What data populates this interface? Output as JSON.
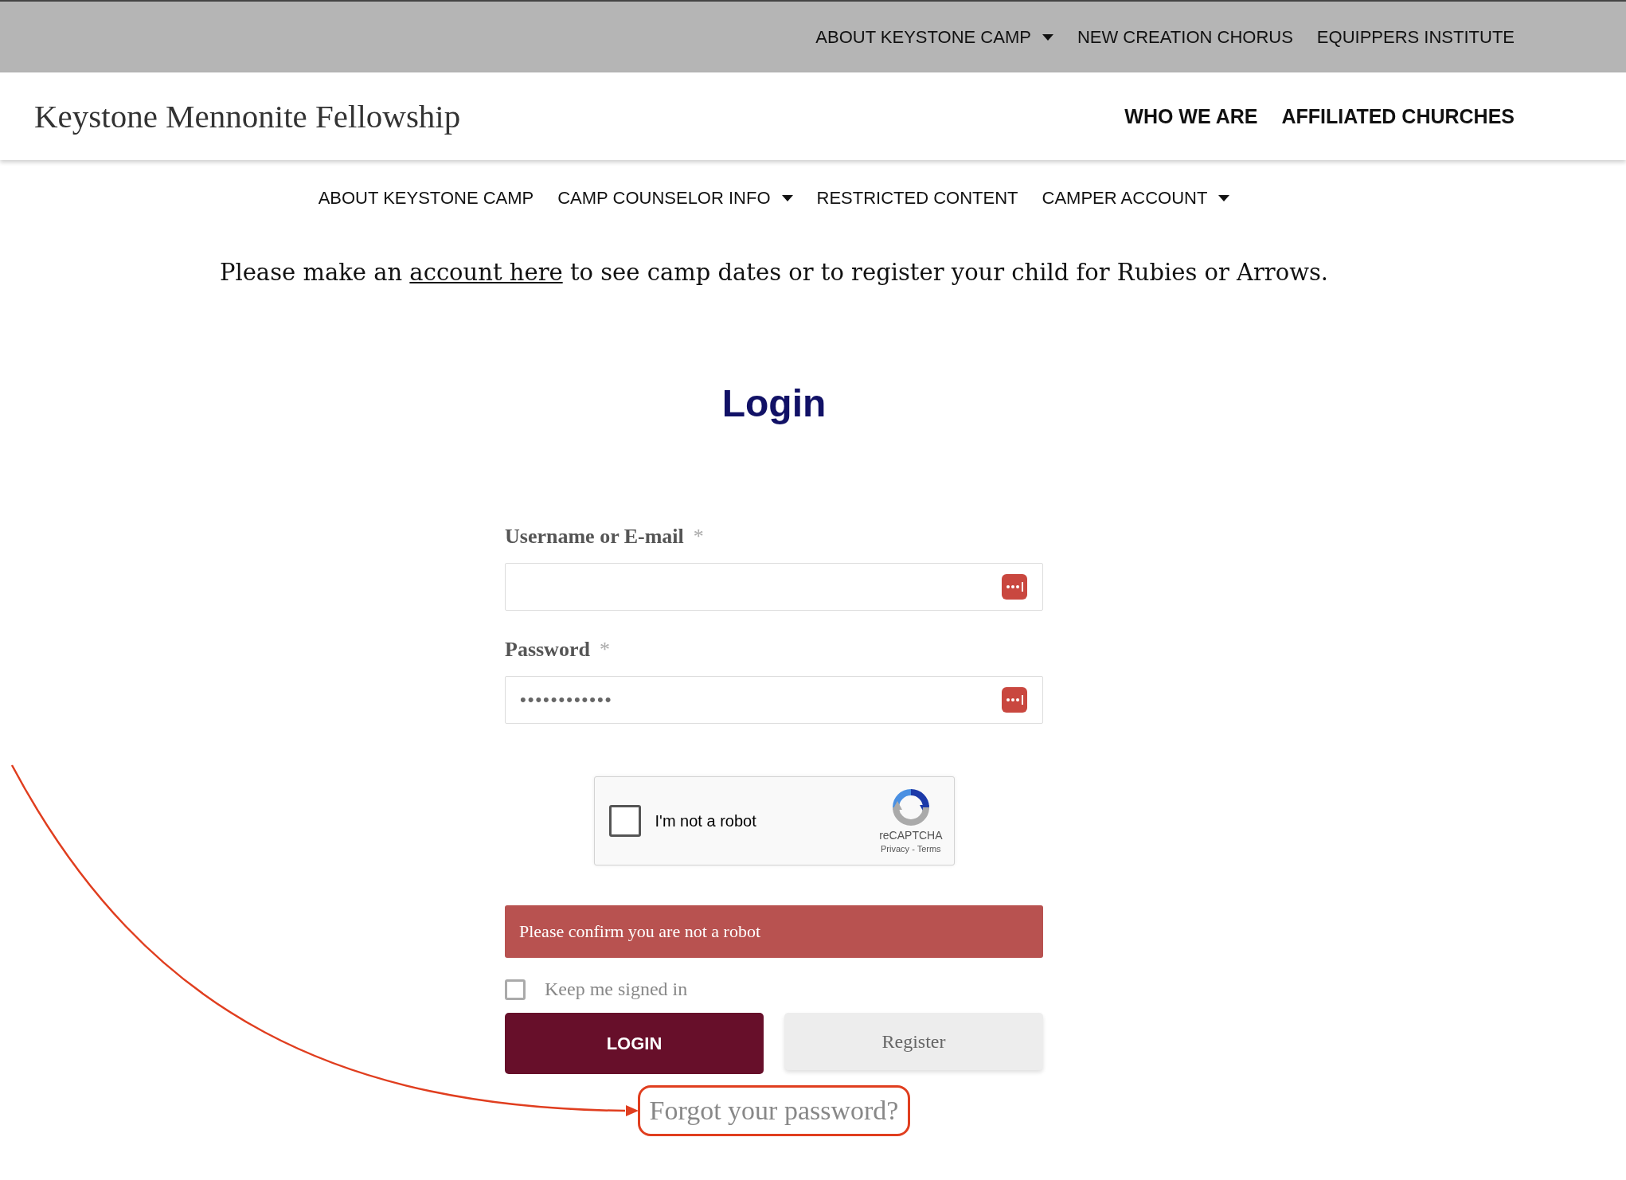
{
  "top_nav": [
    {
      "label": "ABOUT KEYSTONE CAMP",
      "dropdown": true
    },
    {
      "label": "NEW CREATION CHORUS",
      "dropdown": false
    },
    {
      "label": "EQUIPPERS INSTITUTE",
      "dropdown": false
    }
  ],
  "site_title": "Keystone Mennonite Fellowship",
  "main_nav": [
    {
      "label": "WHO WE ARE",
      "dropdown": false
    },
    {
      "label": "AFFILIATED CHURCHES",
      "dropdown": false
    }
  ],
  "sub_nav": [
    {
      "label": "ABOUT KEYSTONE CAMP",
      "dropdown": false
    },
    {
      "label": "CAMP COUNSELOR INFO",
      "dropdown": true
    },
    {
      "label": "RESTRICTED CONTENT",
      "dropdown": false
    },
    {
      "label": "CAMPER ACCOUNT",
      "dropdown": true
    }
  ],
  "notice": {
    "before": "Please make an",
    "link": "account here",
    "after": "to see camp dates or to register your child for Rubies or Arrows."
  },
  "login_form": {
    "title": "Login",
    "fields": [
      {
        "label": "Username or E-mail",
        "required_mark": "*",
        "kind": "text"
      },
      {
        "label": "Password",
        "required_mark": "*",
        "kind": "password",
        "value": "••••••••••••"
      }
    ],
    "captcha": {
      "label": "I'm not a robot",
      "checked": false,
      "brand": "reCAPTCHA",
      "footer": "Privacy - Terms"
    },
    "error": "Please confirm you are not a robot",
    "remember": {
      "label": "Keep me signed in",
      "checked": false
    },
    "buttons": [
      {
        "label": "LOGIN",
        "kind": "primary"
      },
      {
        "label": "Register",
        "kind": "secondary"
      }
    ],
    "forgot_link": {
      "label": "Forgot your password?",
      "highlighted": true
    }
  }
}
